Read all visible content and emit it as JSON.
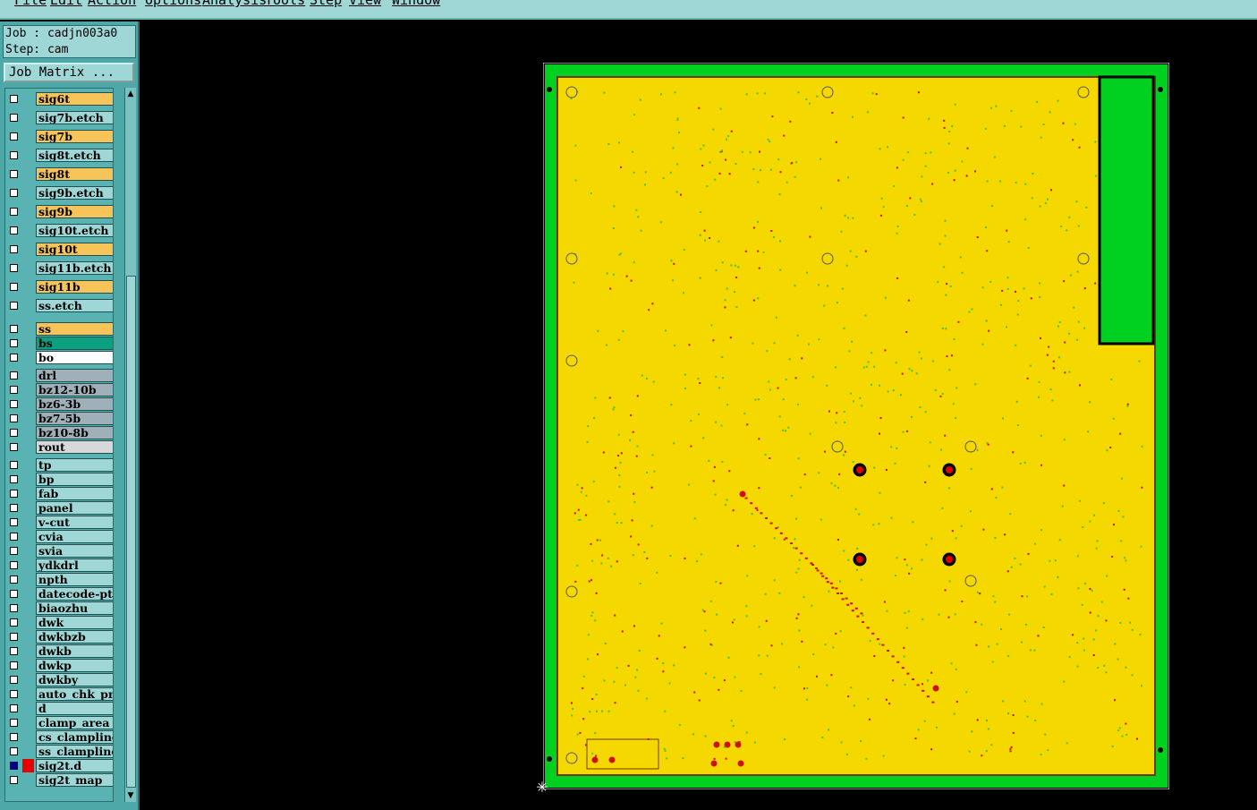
{
  "menubar": {
    "items": [
      "File",
      "Edit",
      "Action",
      "Options",
      "Analysis",
      "Tools",
      "Step",
      "View",
      "Window"
    ]
  },
  "job": {
    "job_line": "Job : cadjn003a0",
    "step_line": "Step: cam"
  },
  "job_matrix_label": "Job Matrix ...",
  "layers": [
    {
      "name": "sig6t",
      "color": "#f7c45a"
    },
    {
      "name": "sig7b.etch",
      "color": "#9fd6d6"
    },
    {
      "name": "sig7b",
      "color": "#f7c45a"
    },
    {
      "name": "sig8t.etch",
      "color": "#9fd6d6"
    },
    {
      "name": "sig8t",
      "color": "#f7c45a"
    },
    {
      "name": "sig9b.etch",
      "color": "#9fd6d6"
    },
    {
      "name": "sig9b",
      "color": "#f7c45a"
    },
    {
      "name": "sig10t.etch",
      "color": "#9fd6d6"
    },
    {
      "name": "sig10t",
      "color": "#f7c45a"
    },
    {
      "name": "sig11b.etch",
      "color": "#9fd6d6"
    },
    {
      "name": "sig11b",
      "color": "#f7c45a"
    },
    {
      "name": "ss.etch",
      "color": "#9fd6d6"
    },
    {
      "name": "ss",
      "color": "#f7c45a"
    },
    {
      "name": "bs",
      "color": "#0aa080"
    },
    {
      "name": "bo",
      "color": "#ffffff"
    },
    {
      "name": "drl",
      "color": "#9fb0b8"
    },
    {
      "name": "bz12-10b",
      "color": "#9fb0b8"
    },
    {
      "name": "bz6-3b",
      "color": "#9fb0b8"
    },
    {
      "name": "bz7-5b",
      "color": "#9fb0b8"
    },
    {
      "name": "bz10-8b",
      "color": "#9fb0b8"
    },
    {
      "name": "rout",
      "color": "#d8d8d8"
    },
    {
      "name": "tp",
      "color": "#9fd6d6"
    },
    {
      "name": "bp",
      "color": "#9fd6d6"
    },
    {
      "name": "fab",
      "color": "#9fd6d6"
    },
    {
      "name": "panel",
      "color": "#9fd6d6"
    },
    {
      "name": "v-cut",
      "color": "#9fd6d6"
    },
    {
      "name": "cvia",
      "color": "#9fd6d6"
    },
    {
      "name": "svia",
      "color": "#9fd6d6"
    },
    {
      "name": "ydkdrl",
      "color": "#9fd6d6"
    },
    {
      "name": "npth",
      "color": "#9fd6d6"
    },
    {
      "name": "datecode-ptc",
      "color": "#9fd6d6"
    },
    {
      "name": "biaozhu",
      "color": "#9fd6d6"
    },
    {
      "name": "dwk",
      "color": "#9fd6d6"
    },
    {
      "name": "dwkbzb",
      "color": "#9fd6d6"
    },
    {
      "name": "dwkb",
      "color": "#9fd6d6"
    },
    {
      "name": "dwkp",
      "color": "#9fd6d6"
    },
    {
      "name": "dwkby",
      "color": "#9fd6d6"
    },
    {
      "name": "auto_chk_pnl",
      "color": "#9fd6d6"
    },
    {
      "name": "d",
      "color": "#9fd6d6"
    },
    {
      "name": "clamp_area",
      "color": "#9fd6d6"
    },
    {
      "name": "cs_clampline",
      "color": "#9fd6d6"
    },
    {
      "name": "ss_clampline",
      "color": "#9fd6d6"
    },
    {
      "name": "sig2t.d",
      "color": "#9fd6d6",
      "active": true
    },
    {
      "name": "sig2t_map",
      "color": "#9fd6d6"
    }
  ],
  "colors": {
    "board_fill": "#f5d800",
    "frame": "#00d020",
    "pad": "#d01010"
  },
  "icons": {
    "origin": "crosshair-icon",
    "scroll_up": "triangle-up-icon",
    "scroll_down": "triangle-down-icon"
  }
}
